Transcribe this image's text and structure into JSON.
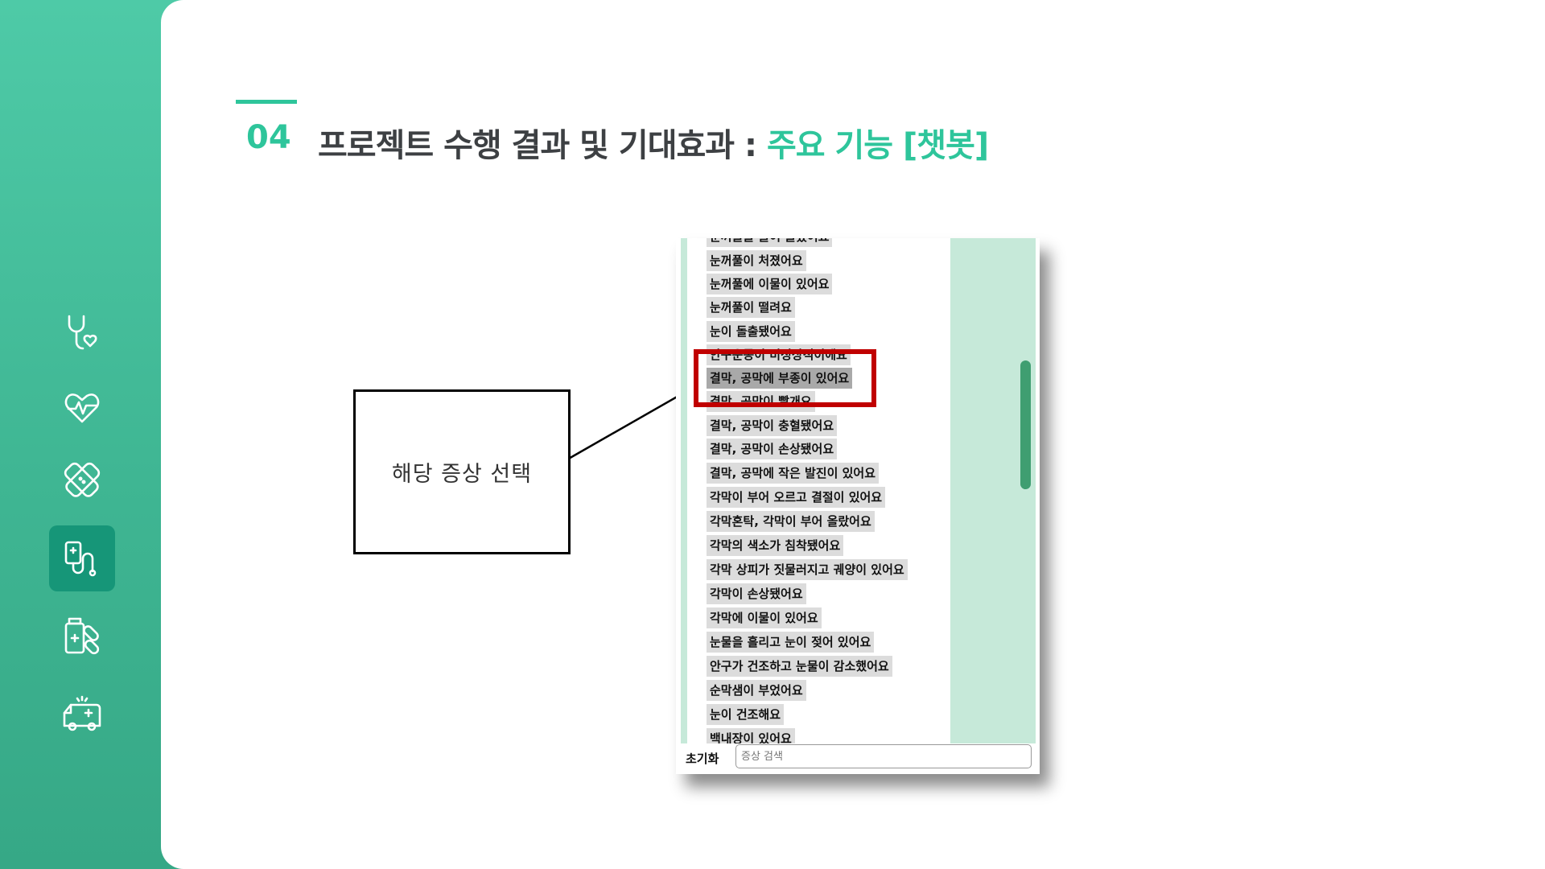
{
  "header": {
    "section_number": "04",
    "title_main": "프로젝트 수행 결과 및 기대효과 : ",
    "title_highlight": "주요 기능 [챗봇]"
  },
  "sidebar": {
    "icons": [
      "stethoscope-heart-icon",
      "heart-pulse-icon",
      "bandage-icon",
      "iv-stethoscope-icon",
      "medicine-pills-icon",
      "ambulance-icon"
    ],
    "active_index": 3
  },
  "callout": {
    "text": "해당 증상 선택"
  },
  "chatbot": {
    "symptoms": [
      "눈꺼풀을 들어 올렸어요",
      "눈꺼풀이 처졌어요",
      "눈꺼풀에 이물이 있어요",
      "눈꺼풀이 떨려요",
      "눈이 돌출됐어요",
      "안구운동이 비정상적이에요",
      "결막, 공막에 부종이 있어요",
      "결막, 공막이 빨개요",
      "결막, 공막이 충혈됐어요",
      "결막, 공막이 손상됐어요",
      "결막, 공막에 작은 발진이 있어요",
      "각막이 부어 오르고 결절이 있어요",
      "각막혼탁, 각막이 부어 올랐어요",
      "각막의 색소가 침착됐어요",
      "각막 상피가 짓물러지고 궤양이 있어요",
      "각막이 손상됐어요",
      "각막에 이물이 있어요",
      "눈물을 흘리고 눈이 젖어 있어요",
      "안구가 건조하고 눈물이 감소했어요",
      "순막샘이 부었어요",
      "눈이 건조해요",
      "백내장이 있어요"
    ],
    "selected_index": 6,
    "reset_label": "초기화",
    "search_placeholder": "증상 검색"
  },
  "colors": {
    "accent": "#2ec59b",
    "sidebar": "#3fb693",
    "active_icon_bg": "#169678",
    "highlight_border": "#c00000"
  }
}
